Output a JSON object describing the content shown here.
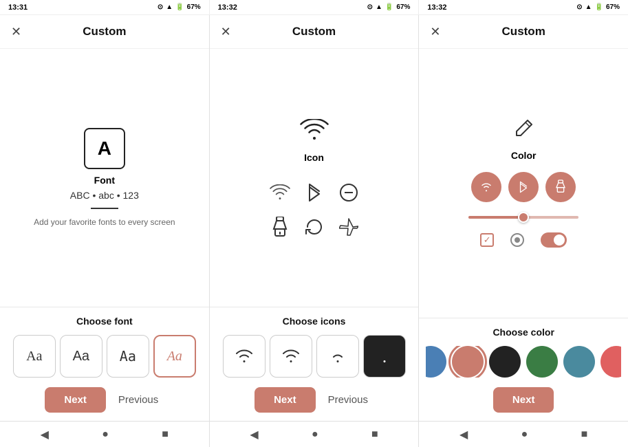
{
  "status_bars": [
    {
      "time": "13:31",
      "battery": "67%"
    },
    {
      "time": "13:32",
      "battery": "67%"
    },
    {
      "time": "13:32",
      "battery": "67%"
    }
  ],
  "panels": [
    {
      "title": "Custom",
      "icon_label": "A",
      "section_label": "Font",
      "font_sample": "ABC • abc • 123",
      "font_desc": "Add your favorite fonts to every screen",
      "choose_label": "Choose font",
      "font_options": [
        "Aa",
        "Aa",
        "Aa",
        "Aa"
      ],
      "font_option_active": 3,
      "btn_next": "Next",
      "btn_prev": "Previous"
    },
    {
      "title": "Custom",
      "section_label": "Icon",
      "choose_label": "Choose icons",
      "btn_next": "Next",
      "btn_prev": "Previous"
    },
    {
      "title": "Custom",
      "section_label": "Color",
      "choose_label": "Choose color",
      "colors": [
        "#4a7fb5",
        "#c97c6e",
        "#222222",
        "#3a7d44",
        "#4a8a9e",
        "#e06060"
      ],
      "selected_color_index": 1,
      "btn_next": "Next"
    }
  ],
  "nav": {
    "back": "◀",
    "home": "●",
    "square": "■"
  }
}
